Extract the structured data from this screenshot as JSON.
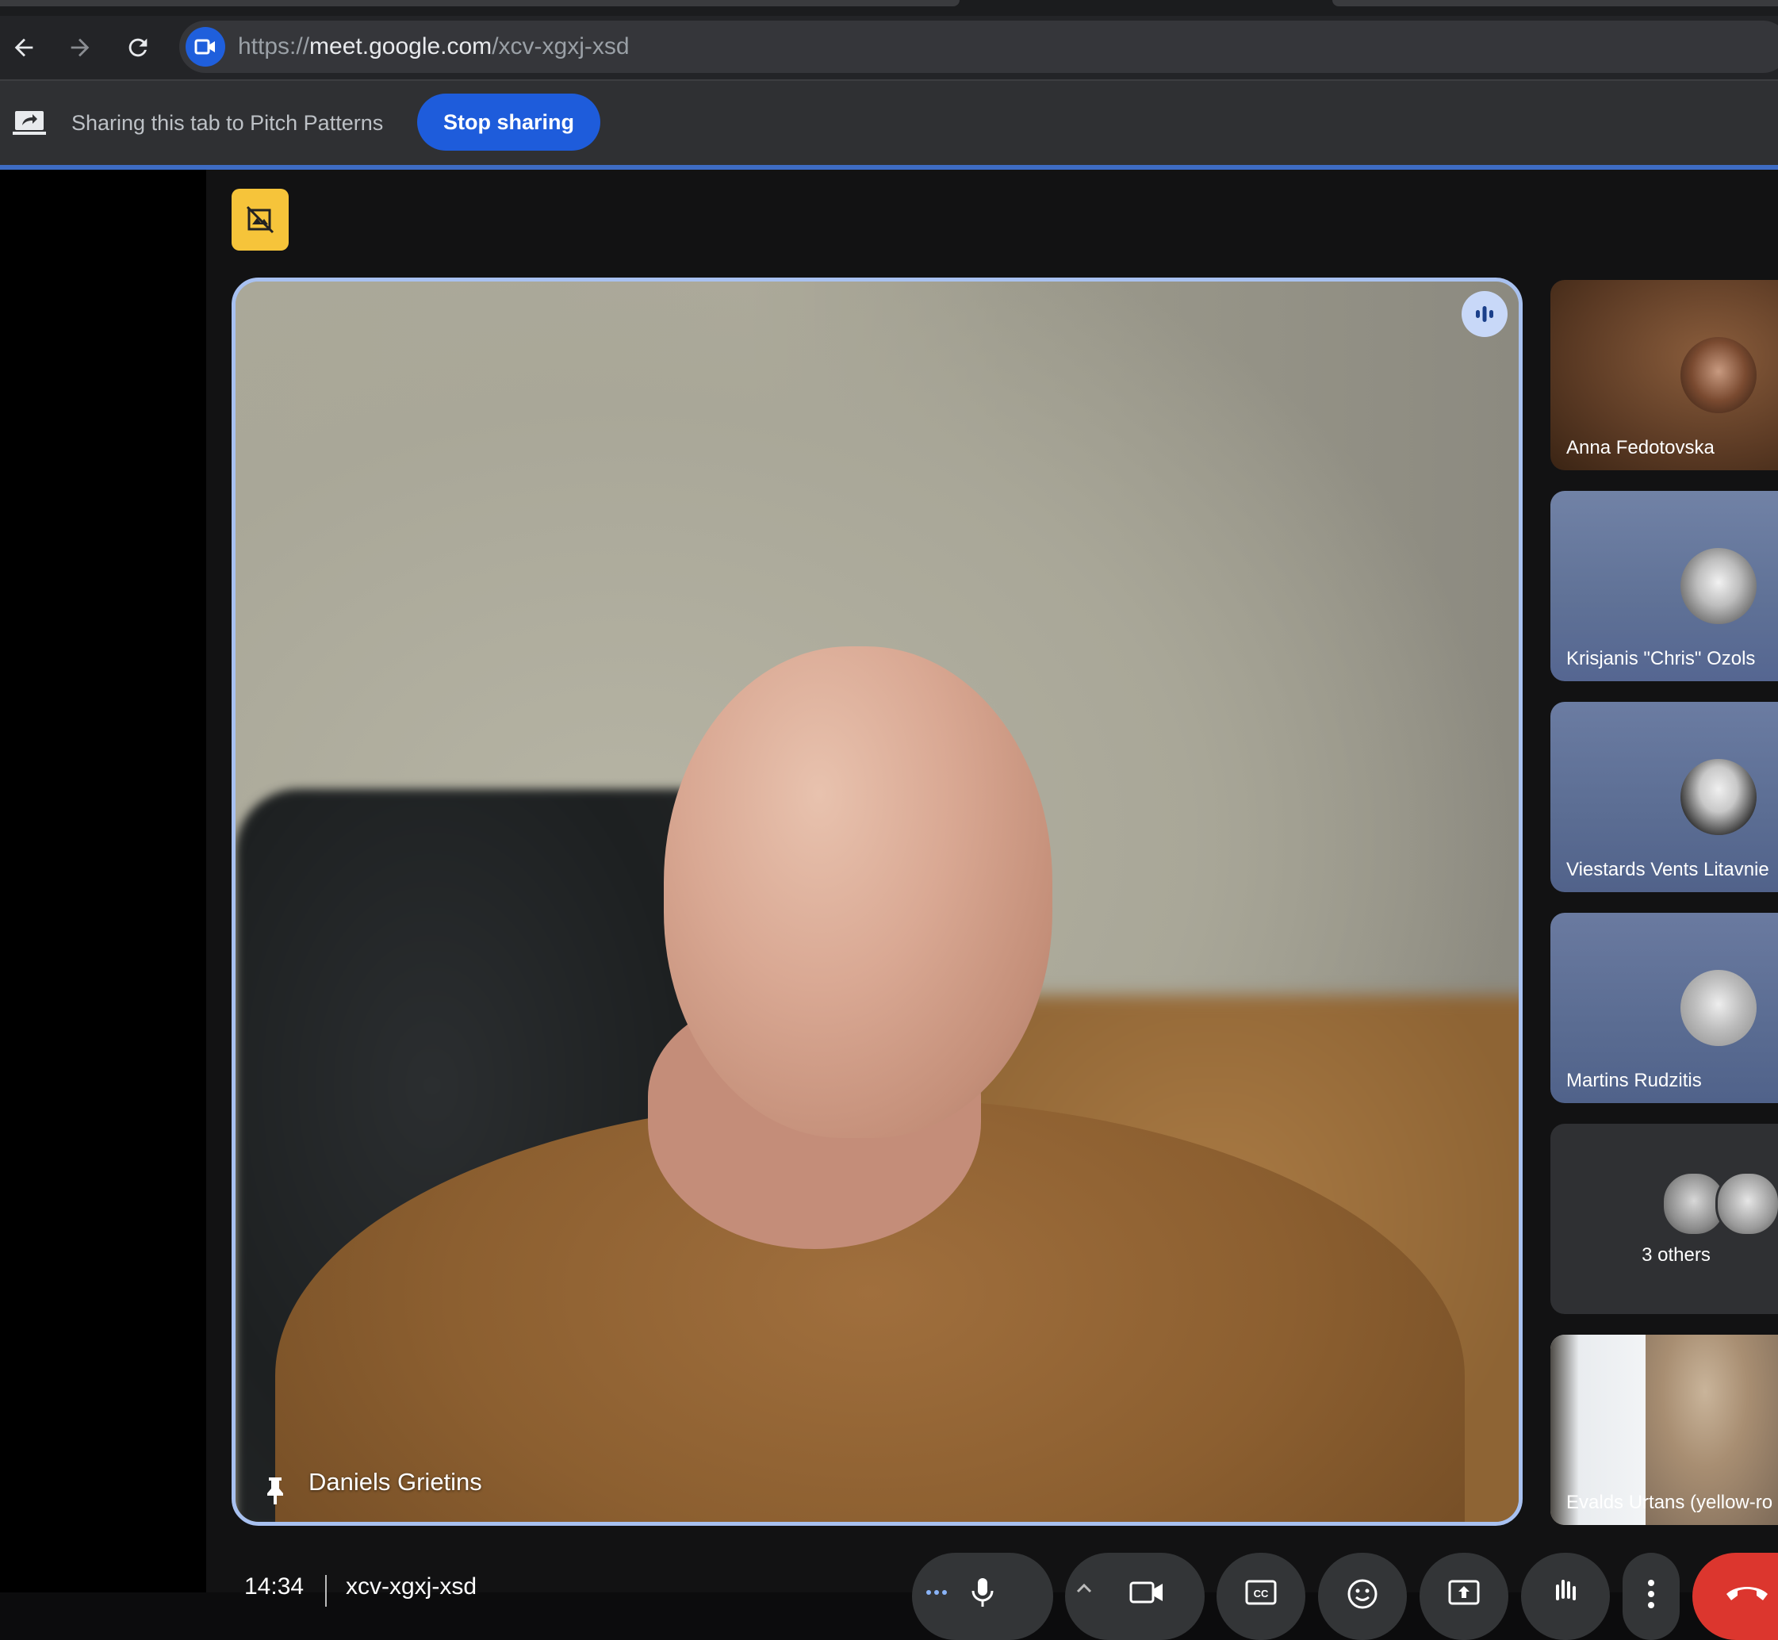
{
  "browser": {
    "url_scheme": "https://",
    "url_host": "meet.google.com",
    "url_path": "/xcv-xgxj-xsd",
    "back_icon": "arrow-left-icon",
    "forward_icon": "arrow-right-icon",
    "reload_icon": "reload-icon"
  },
  "share_bar": {
    "message": "Sharing this tab to Pitch Patterns",
    "stop_label": "Stop sharing"
  },
  "main_speaker": {
    "name": "Daniels Grietins",
    "speaking": true
  },
  "participants": [
    {
      "name": "Anna Fedotovska"
    },
    {
      "name": "Krisjanis \"Chris\" Ozols"
    },
    {
      "name": "Viestards Vents Litavnie"
    },
    {
      "name": "Martins Rudzitis"
    },
    {
      "name": "3 others"
    },
    {
      "name": "Evalds Urtans (yellow-ro"
    }
  ],
  "meeting": {
    "time": "14:34",
    "code": "xcv-xgxj-xsd"
  },
  "colors": {
    "accent_blue": "#1e5cdb",
    "warning_yellow": "#f6c43a",
    "end_call_red": "#dc362e",
    "speaker_border": "#a8c1f0"
  }
}
